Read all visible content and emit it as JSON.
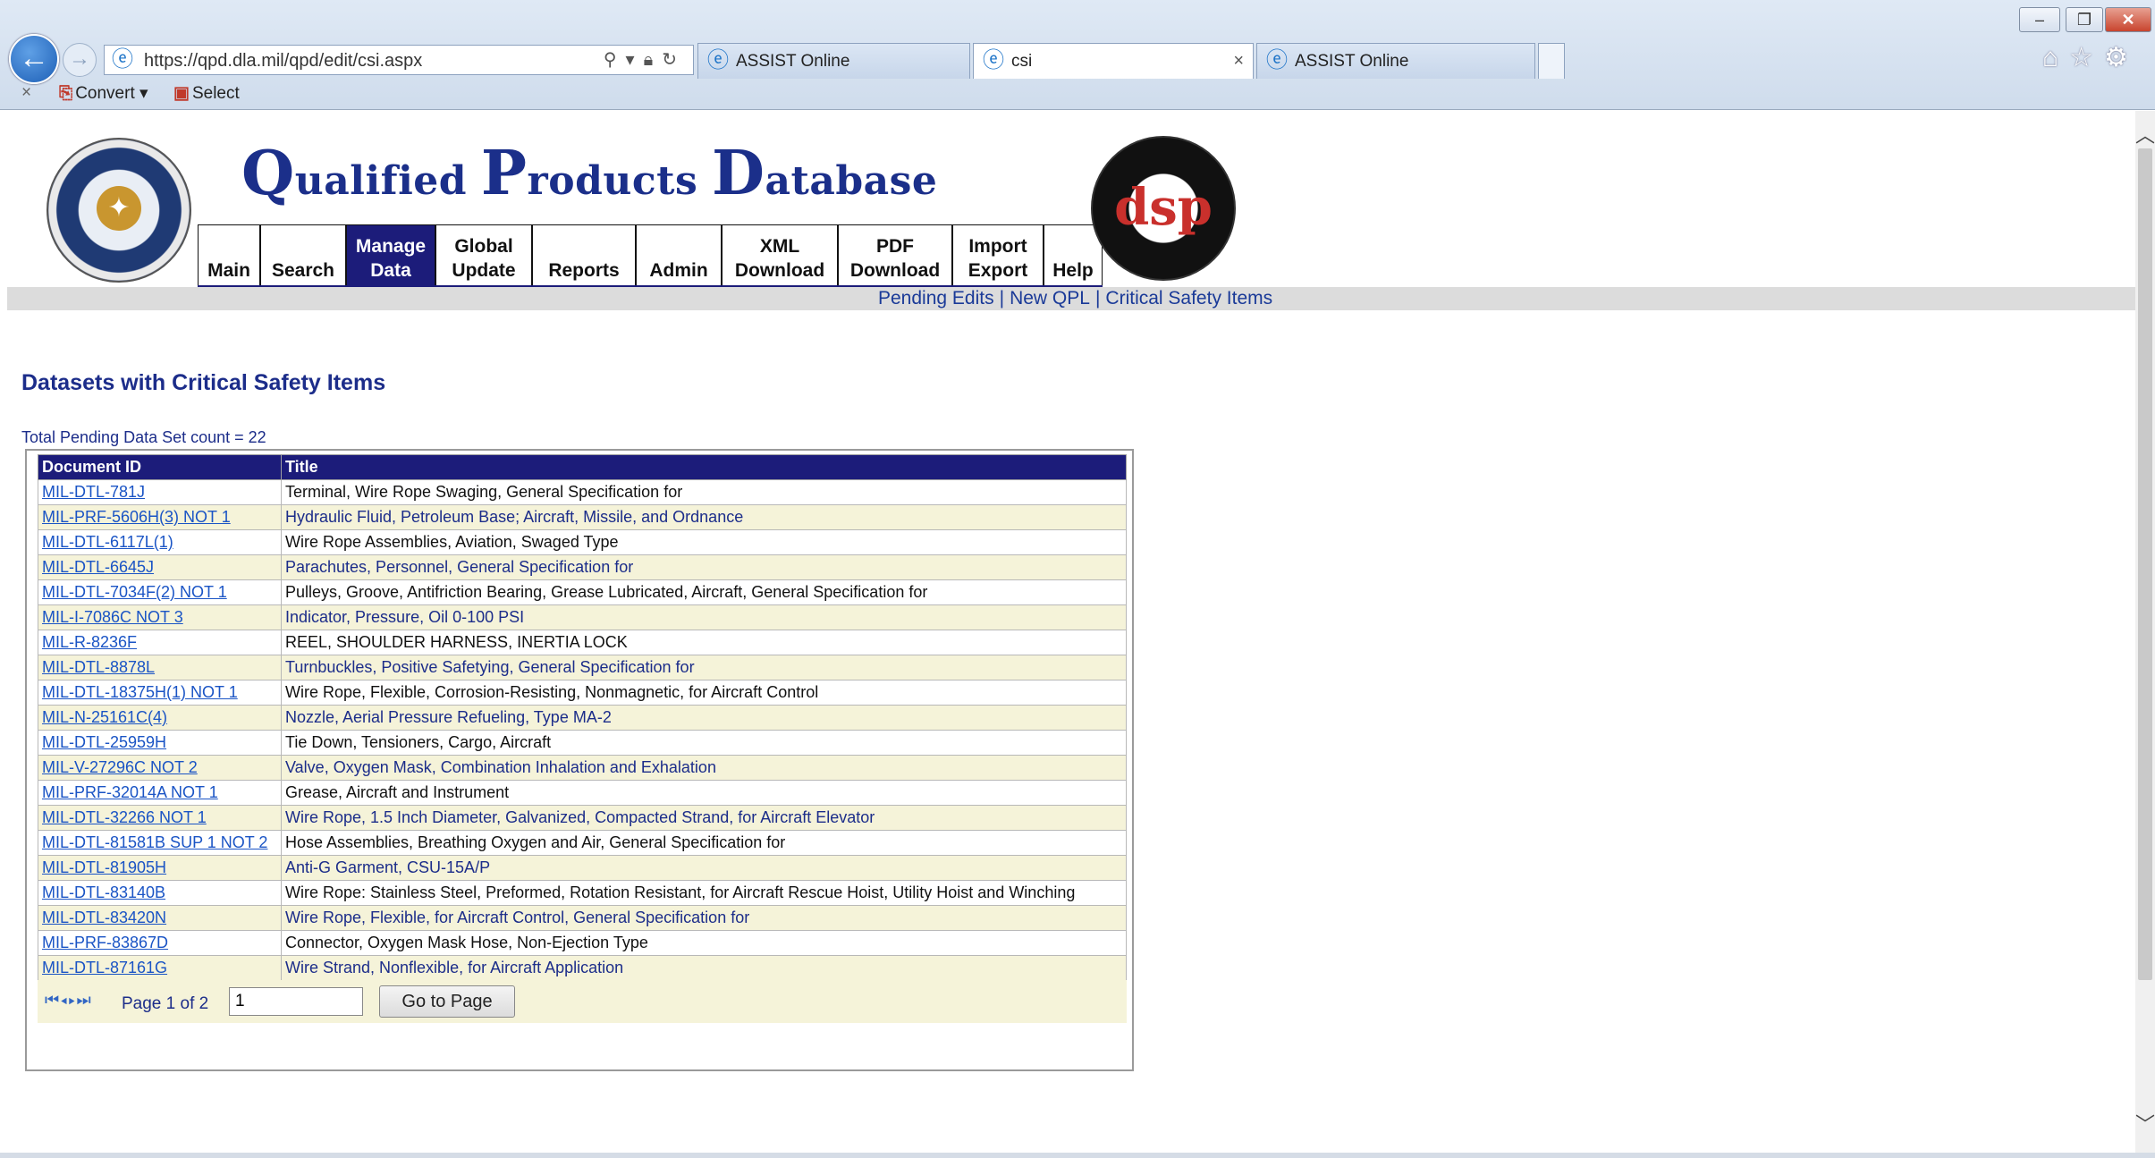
{
  "browser": {
    "url": "https://qpd.dla.mil/qpd/edit/csi.aspx",
    "tabs": [
      {
        "label": "ASSIST Online",
        "active": false
      },
      {
        "label": "csi",
        "active": true,
        "close": "×"
      },
      {
        "label": "ASSIST Online",
        "active": false
      }
    ],
    "commandbar": {
      "close": "×",
      "convert": "Convert",
      "convert_arrow": "▾",
      "select": "Select"
    },
    "window_buttons": {
      "min": "‒",
      "max": "❐",
      "close": "✕"
    }
  },
  "header": {
    "title_q": "Q",
    "title_ualified": "ualified",
    "title_p": "P",
    "title_roducts": "roducts",
    "title_d": "D",
    "title_atabase": "atabase",
    "dsp_letters": "dsp"
  },
  "nav": {
    "items": [
      {
        "label": "Main"
      },
      {
        "label": "Search"
      },
      {
        "label": "Manage\nData",
        "active": true
      },
      {
        "label": "Global\nUpdate"
      },
      {
        "label": "Reports"
      },
      {
        "label": "Admin"
      },
      {
        "label": "XML\nDownload"
      },
      {
        "label": "PDF\nDownload"
      },
      {
        "label": "Import\nExport"
      },
      {
        "label": "Help"
      }
    ]
  },
  "subnav": {
    "links": [
      "Pending Edits",
      "New QPL",
      "Critical Safety Items"
    ],
    "separator": "|"
  },
  "main": {
    "title": "Datasets with Critical Safety Items",
    "count_label": "Total Pending Data Set count = 22",
    "table": {
      "headers": [
        "Document ID",
        "Title"
      ],
      "rows": [
        {
          "id": "MIL-DTL-781J",
          "title": "Terminal, Wire Rope Swaging, General Specification for"
        },
        {
          "id": "MIL-PRF-5606H(3) NOT 1",
          "title": "Hydraulic Fluid, Petroleum Base; Aircraft, Missile, and Ordnance"
        },
        {
          "id": "MIL-DTL-6117L(1)",
          "title": "Wire Rope Assemblies, Aviation, Swaged Type"
        },
        {
          "id": "MIL-DTL-6645J",
          "title": "Parachutes, Personnel, General Specification for"
        },
        {
          "id": "MIL-DTL-7034F(2) NOT 1",
          "title": "Pulleys, Groove, Antifriction Bearing, Grease Lubricated, Aircraft, General Specification for"
        },
        {
          "id": "MIL-I-7086C NOT 3",
          "title": "Indicator, Pressure, Oil 0-100 PSI"
        },
        {
          "id": "MIL-R-8236F",
          "title": "REEL, SHOULDER HARNESS, INERTIA LOCK"
        },
        {
          "id": "MIL-DTL-8878L",
          "title": "Turnbuckles, Positive Safetying, General Specification for"
        },
        {
          "id": "MIL-DTL-18375H(1) NOT 1",
          "title": "Wire Rope, Flexible, Corrosion-Resisting, Nonmagnetic, for Aircraft Control"
        },
        {
          "id": "MIL-N-25161C(4)",
          "title": "Nozzle, Aerial Pressure Refueling, Type MA-2"
        },
        {
          "id": "MIL-DTL-25959H",
          "title": "Tie Down, Tensioners, Cargo, Aircraft"
        },
        {
          "id": "MIL-V-27296C NOT 2",
          "title": "Valve, Oxygen Mask, Combination Inhalation and Exhalation"
        },
        {
          "id": "MIL-PRF-32014A NOT 1",
          "title": "Grease, Aircraft and Instrument"
        },
        {
          "id": "MIL-DTL-32266 NOT 1",
          "title": "Wire Rope, 1.5 Inch Diameter, Galvanized, Compacted Strand, for Aircraft Elevator"
        },
        {
          "id": "MIL-DTL-81581B SUP 1 NOT 2",
          "title": "Hose Assemblies, Breathing Oxygen and Air, General Specification for"
        },
        {
          "id": "MIL-DTL-81905H",
          "title": "Anti-G Garment, CSU-15A/P"
        },
        {
          "id": "MIL-DTL-83140B",
          "title": "Wire Rope: Stainless Steel, Preformed, Rotation Resistant, for Aircraft Rescue Hoist, Utility Hoist and Winching"
        },
        {
          "id": "MIL-DTL-83420N",
          "title": "Wire Rope, Flexible, for Aircraft Control, General Specification for"
        },
        {
          "id": "MIL-PRF-83867D",
          "title": "Connector, Oxygen Mask Hose, Non-Ejection Type"
        },
        {
          "id": "MIL-DTL-87161G",
          "title": "Wire Strand, Nonflexible, for Aircraft Application"
        }
      ]
    },
    "pager": {
      "icons": "◁◁▷▷",
      "label": "Page 1 of 2",
      "input_value": "1",
      "button": "Go to Page"
    }
  },
  "colors": {
    "nav_active": "#1c1c7a",
    "link": "#1a54c5",
    "alt_row": "#f5f3d9",
    "heading": "#1c2d8a"
  }
}
